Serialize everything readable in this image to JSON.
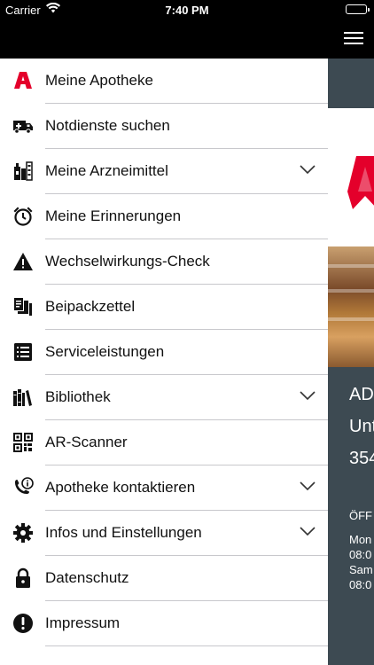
{
  "status_bar": {
    "carrier": "Carrier",
    "time": "7:40 PM"
  },
  "menu": {
    "items": [
      {
        "label": "Meine Apotheke",
        "icon": "pharmacy-a-icon",
        "expandable": false
      },
      {
        "label": "Notdienste suchen",
        "icon": "emergency-van-icon",
        "expandable": false
      },
      {
        "label": "Meine Arzneimittel",
        "icon": "medicine-icon",
        "expandable": true
      },
      {
        "label": "Meine Erinnerungen",
        "icon": "alarm-clock-icon",
        "expandable": false
      },
      {
        "label": "Wechselwirkungs-Check",
        "icon": "warning-icon",
        "expandable": false
      },
      {
        "label": "Beipackzettel",
        "icon": "leaflet-icon",
        "expandable": false
      },
      {
        "label": "Serviceleistungen",
        "icon": "list-icon",
        "expandable": false
      },
      {
        "label": "Bibliothek",
        "icon": "books-icon",
        "expandable": true
      },
      {
        "label": "AR-Scanner",
        "icon": "qr-code-icon",
        "expandable": false
      },
      {
        "label": "Apotheke kontaktieren",
        "icon": "phone-info-icon",
        "expandable": true
      },
      {
        "label": "Infos und Einstellungen",
        "icon": "gear-icon",
        "expandable": true
      },
      {
        "label": "Datenschutz",
        "icon": "lock-icon",
        "expandable": false
      },
      {
        "label": "Impressum",
        "icon": "info-alert-icon",
        "expandable": false
      }
    ]
  },
  "background": {
    "line1": "AD",
    "line2": "Unt",
    "line3": "354",
    "hours_title": "ÖFF",
    "hours_line1": "Mon",
    "hours_line2": "08:0",
    "hours_line3": "Sam",
    "hours_line4": "08:0"
  },
  "colors": {
    "accent_red": "#e4002b",
    "header": "#000000",
    "panel": "#3d4a52"
  }
}
